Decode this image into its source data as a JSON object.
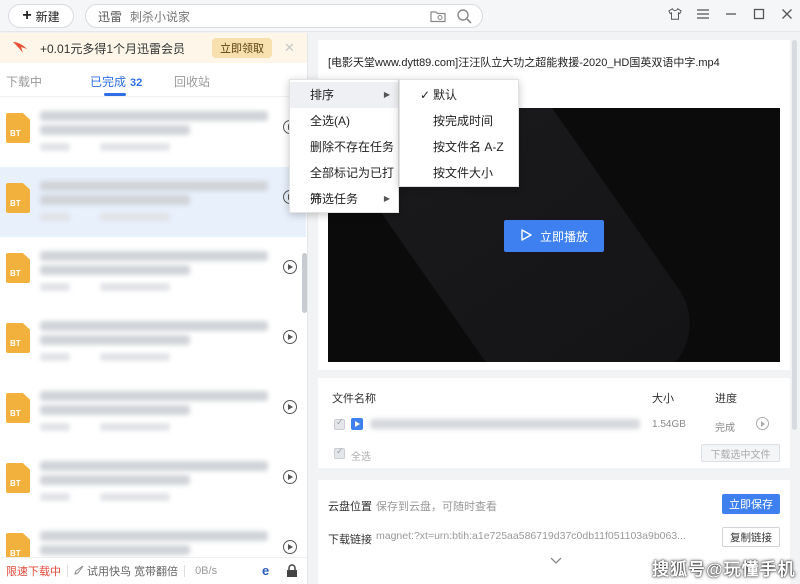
{
  "topbar": {
    "new_label": "新建",
    "search_brand": "迅雷",
    "search_placeholder": "刺杀小说家"
  },
  "promo": {
    "text": "+0.01元多得1个月迅雷会员",
    "claim_label": "立即领取"
  },
  "tabs": {
    "downloading": "下载中",
    "completed": "已完成",
    "completed_count": "32",
    "recycle": "回收站"
  },
  "list": {
    "badge": "BT",
    "row_count": 7,
    "selected_index": 1
  },
  "statusbar": {
    "limit": "限速下载中",
    "trial": "试用快鸟 宽带翻倍",
    "speed": "0B/s"
  },
  "context_menu": {
    "items": [
      "排序",
      "全选(A)",
      "删除不存在任务",
      "全部标记为已打开",
      "筛选任务"
    ],
    "sort_submenu": [
      "默认",
      "按完成时间",
      "按文件名 A-Z",
      "按文件大小"
    ],
    "checked_sort": "默认"
  },
  "player": {
    "title": "[电影天堂www.dytt89.com]汪汪队立大功之超能救援-2020_HD国英双语中字.mp4",
    "play_label": "立即播放"
  },
  "files": {
    "header_name": "文件名称",
    "header_size": "大小",
    "header_progress": "进度",
    "row": {
      "size": "1.54GB",
      "progress": "完成"
    },
    "select_all": "全选",
    "download_selected": "下载选中文件"
  },
  "cloud": {
    "label": "云盘位置",
    "value": "保存到云盘，可随时查看",
    "save_label": "立即保存",
    "link_label": "下载链接",
    "magnet": "magnet:?xt=urn:btih:a1e725aa586719d37c0db11f051103a9b063...",
    "copy_label": "复制链接"
  },
  "watermark": "搜狐号@玩懂手机"
}
